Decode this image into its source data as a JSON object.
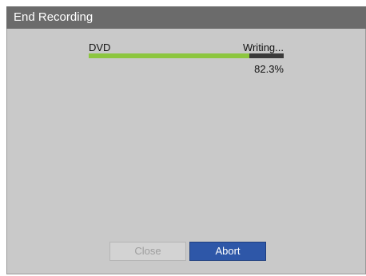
{
  "dialog": {
    "title": "End Recording"
  },
  "recording": {
    "device": "DVD",
    "status": "Writing...",
    "progress_percent": 82.3,
    "progress_text": "82.3%"
  },
  "buttons": {
    "close_label": "Close",
    "abort_label": "Abort"
  },
  "colors": {
    "titlebar": "#6b6b6b",
    "panel": "#c9c9c9",
    "progress_fill": "#8cc63f",
    "progress_track": "#3a3a3a",
    "abort_button": "#2e57a8",
    "close_button_disabled": "#d3d3d3"
  }
}
